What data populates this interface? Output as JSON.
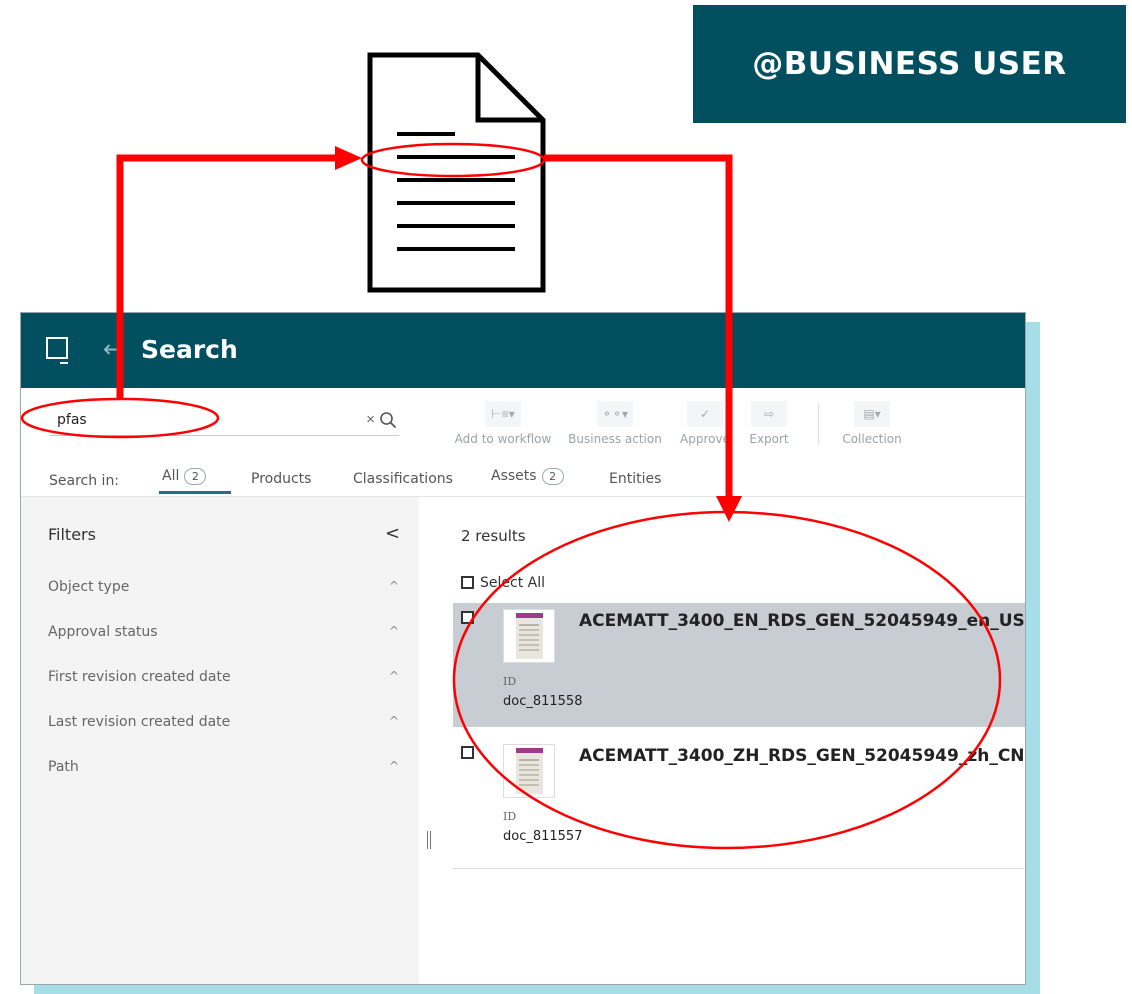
{
  "badge": {
    "text": "@BUSINESS USER"
  },
  "header": {
    "back_icon": "←",
    "title": "Search"
  },
  "search": {
    "value": "pfas",
    "clear": "×"
  },
  "toolbar": [
    {
      "icon": "workflow-icon",
      "glyph": "⊢≡▾",
      "label": "Add to workflow"
    },
    {
      "icon": "business-action-icon",
      "glyph": "⚬⚬▾",
      "label": "Business action"
    },
    {
      "icon": "check-icon",
      "glyph": "✓",
      "label": "Approve"
    },
    {
      "icon": "export-icon",
      "glyph": "⇨",
      "label": "Export"
    },
    {
      "icon": "collection-icon",
      "glyph": "▤▾",
      "label": "Collection"
    }
  ],
  "tabs": {
    "label": "Search in:",
    "items": [
      {
        "label": "All",
        "count": "2"
      },
      {
        "label": "Products",
        "count": ""
      },
      {
        "label": "Classifications",
        "count": ""
      },
      {
        "label": "Assets",
        "count": "2"
      },
      {
        "label": "Entities",
        "count": ""
      }
    ]
  },
  "filters": {
    "title": "Filters",
    "collapse": "<",
    "rows": [
      {
        "label": "Object type",
        "chev": "^"
      },
      {
        "label": "Approval status",
        "chev": "^"
      },
      {
        "label": "First revision created date",
        "chev": "^"
      },
      {
        "label": "Last revision created date",
        "chev": "^"
      },
      {
        "label": "Path",
        "chev": "^"
      }
    ]
  },
  "results": {
    "count_text": "2 results",
    "select_all": "Select All",
    "items": [
      {
        "name": "ACEMATT_3400_EN_RDS_GEN_52045949_en_US",
        "id_label": "ID",
        "id_value": "doc_811558",
        "selected": true
      },
      {
        "name": "ACEMATT_3400_ZH_RDS_GEN_52045949_zh_CN",
        "id_label": "ID",
        "id_value": "doc_811557",
        "selected": false
      }
    ]
  },
  "colors": {
    "brand": "#02505f",
    "annotation": "#ff0000",
    "shadow": "#a6dde6",
    "selected_row": "#c8cdd3"
  }
}
